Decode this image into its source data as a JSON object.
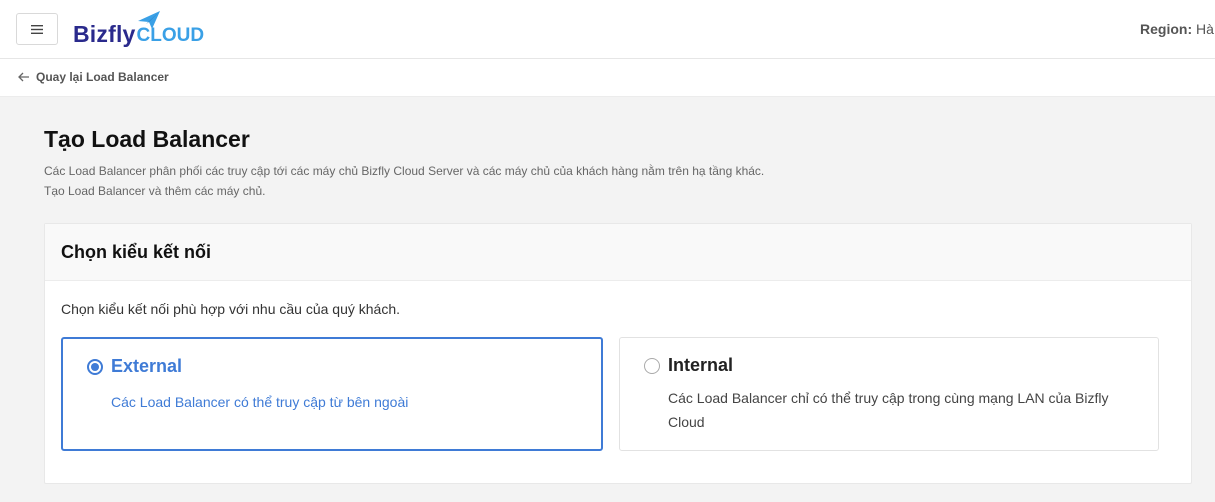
{
  "header": {
    "logo_main": "Bizfly",
    "logo_sub": "CLOUD",
    "region_label": "Region:",
    "region_value": "Hà N"
  },
  "breadcrumb": {
    "back_label": "Quay lại Load Balancer"
  },
  "page": {
    "title": "Tạo Load Balancer",
    "desc_line1": "Các Load Balancer phân phối các truy cập tới các máy chủ Bizfly Cloud Server và các máy chủ của khách hàng nằm trên hạ tầng khác.",
    "desc_line2": "Tạo Load Balancer và thêm các máy chủ."
  },
  "connection": {
    "heading": "Chọn kiểu kết nối",
    "subtitle": "Chọn kiểu kết nối phù hợp với nhu cầu của quý khách.",
    "options": [
      {
        "title": "External",
        "desc": "Các Load Balancer có thể truy cập từ bên ngoài",
        "selected": true
      },
      {
        "title": "Internal",
        "desc": "Các Load Balancer chỉ có thể truy cập trong cùng mạng LAN của Bizfly Cloud",
        "selected": false
      }
    ]
  },
  "colors": {
    "accent": "#3f7bd6",
    "brand": "#2a2a8c",
    "brand_cloud": "#3aa0e6"
  }
}
